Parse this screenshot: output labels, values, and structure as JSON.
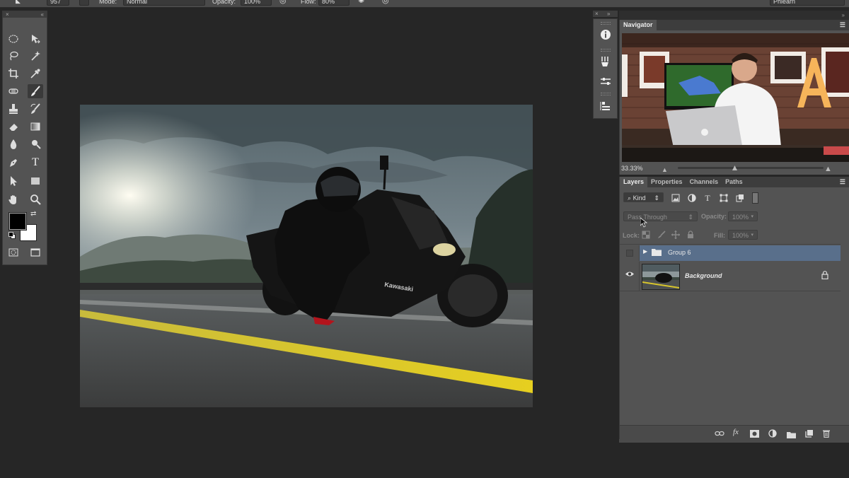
{
  "options_bar": {
    "brush_size": "957",
    "mode_label": "Mode:",
    "mode_value": "Normal",
    "opacity_label": "Opacity:",
    "opacity_value": "100%",
    "flow_label": "Flow:",
    "flow_value": "80%",
    "workspace": "Phlearn"
  },
  "tools": [
    "elliptical-marquee",
    "move",
    "lasso",
    "magic-wand",
    "crop",
    "eyedropper",
    "spot-healing",
    "brush",
    "clone-stamp",
    "history-brush",
    "eraser",
    "gradient",
    "blur",
    "dodge",
    "pen",
    "type",
    "path-selection",
    "rectangle",
    "hand",
    "zoom",
    "quick-mask",
    "screen-mode"
  ],
  "active_tool": "brush",
  "colors": {
    "foreground": "#000000",
    "background": "#ffffff",
    "accent": "#596f8b"
  },
  "navigator": {
    "tab": "Navigator",
    "zoom": "33.33%"
  },
  "layers_panel": {
    "tabs": [
      "Layers",
      "Properties",
      "Channels",
      "Paths"
    ],
    "filter_kind": "Kind",
    "blend_mode": "Pass Through",
    "opacity_label": "Opacity:",
    "opacity_value": "100%",
    "lock_label": "Lock:",
    "fill_label": "Fill:",
    "fill_value": "100%",
    "layers": [
      {
        "name": "Group 6",
        "type": "group",
        "visible": false,
        "selected": true
      },
      {
        "name": "Background",
        "type": "image",
        "visible": true,
        "locked": true,
        "selected": false
      }
    ],
    "footer_icons": [
      "link-icon",
      "fx-icon",
      "mask-icon",
      "adjustment-icon",
      "folder-icon",
      "new-layer-icon",
      "trash-icon"
    ]
  }
}
